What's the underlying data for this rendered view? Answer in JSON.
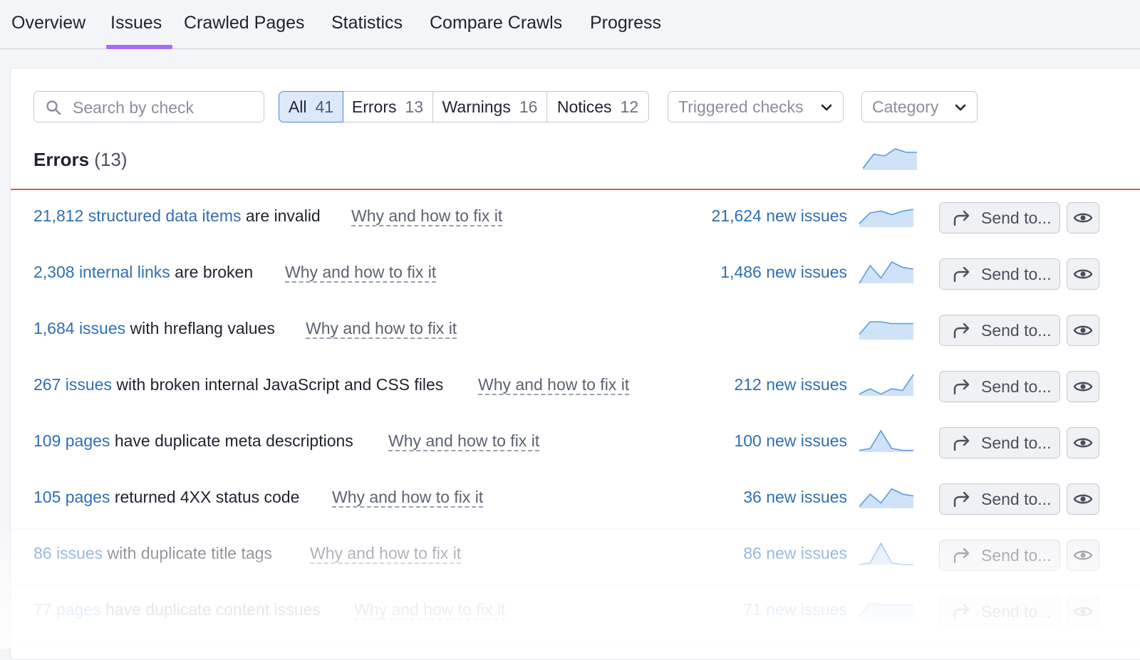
{
  "tabs": [
    {
      "label": "Overview"
    },
    {
      "label": "Issues"
    },
    {
      "label": "Crawled Pages"
    },
    {
      "label": "Statistics"
    },
    {
      "label": "Compare Crawls"
    },
    {
      "label": "Progress"
    }
  ],
  "active_tab": "Issues",
  "search": {
    "placeholder": "Search by check"
  },
  "filters": [
    {
      "label": "All",
      "count": "41"
    },
    {
      "label": "Errors",
      "count": "13"
    },
    {
      "label": "Warnings",
      "count": "16"
    },
    {
      "label": "Notices",
      "count": "12"
    }
  ],
  "dropdowns": {
    "triggered": "Triggered checks",
    "category": "Category"
  },
  "section": {
    "title": "Errors",
    "count": "(13)"
  },
  "colors": {
    "accent_tab": "#a66cf5",
    "error_bar": "#dc5a5a",
    "link": "#2f6fb3",
    "spark_fill": "#cfe2f7",
    "spark_line": "#5a9be0"
  },
  "rows": [
    {
      "link": "21,812 structured data items",
      "text": " are invalid",
      "fix": "Why and how to fix it",
      "new": "21,624 new issues",
      "send": "Send to...",
      "trend": [
        2,
        8,
        9,
        7,
        9,
        10
      ]
    },
    {
      "link": "2,308 internal links",
      "text": " are broken",
      "fix": "Why and how to fix it",
      "new": "1,486 new issues",
      "send": "Send to...",
      "trend": [
        0,
        10,
        3,
        12,
        9,
        8
      ]
    },
    {
      "link": "1,684 issues",
      "text": " with hreflang values",
      "fix": "Why and how to fix it",
      "new": "",
      "send": "Send to...",
      "trend": [
        3,
        10,
        10,
        9,
        9,
        9
      ]
    },
    {
      "link": "267 issues",
      "text": " with broken internal JavaScript and CSS files",
      "fix": "Why and how to fix it",
      "new": "212 new issues",
      "send": "Send to...",
      "trend": [
        1,
        4,
        1,
        4,
        3,
        12
      ]
    },
    {
      "link": "109 pages",
      "text": " have duplicate meta descriptions",
      "fix": "Why and how to fix it",
      "new": "100 new issues",
      "send": "Send to...",
      "trend": [
        1,
        2,
        12,
        2,
        1,
        1
      ]
    },
    {
      "link": "105 pages",
      "text": " returned 4XX status code",
      "fix": "Why and how to fix it",
      "new": "36 new issues",
      "send": "Send to...",
      "trend": [
        1,
        8,
        3,
        11,
        8,
        7
      ]
    },
    {
      "link": "86 issues",
      "text": " with duplicate title tags",
      "fix": "Why and how to fix it",
      "new": "86 new issues",
      "send": "Send to...",
      "trend": [
        0,
        1,
        12,
        1,
        0,
        0
      ]
    },
    {
      "link": "77 pages",
      "text": " have duplicate content issues",
      "fix": "Why and how to fix it",
      "new": "71 new issues",
      "send": "Send to...",
      "trend": [
        3,
        10,
        9,
        9,
        9,
        9
      ]
    }
  ],
  "header_trend": [
    1,
    9,
    8,
    12,
    10,
    10
  ]
}
